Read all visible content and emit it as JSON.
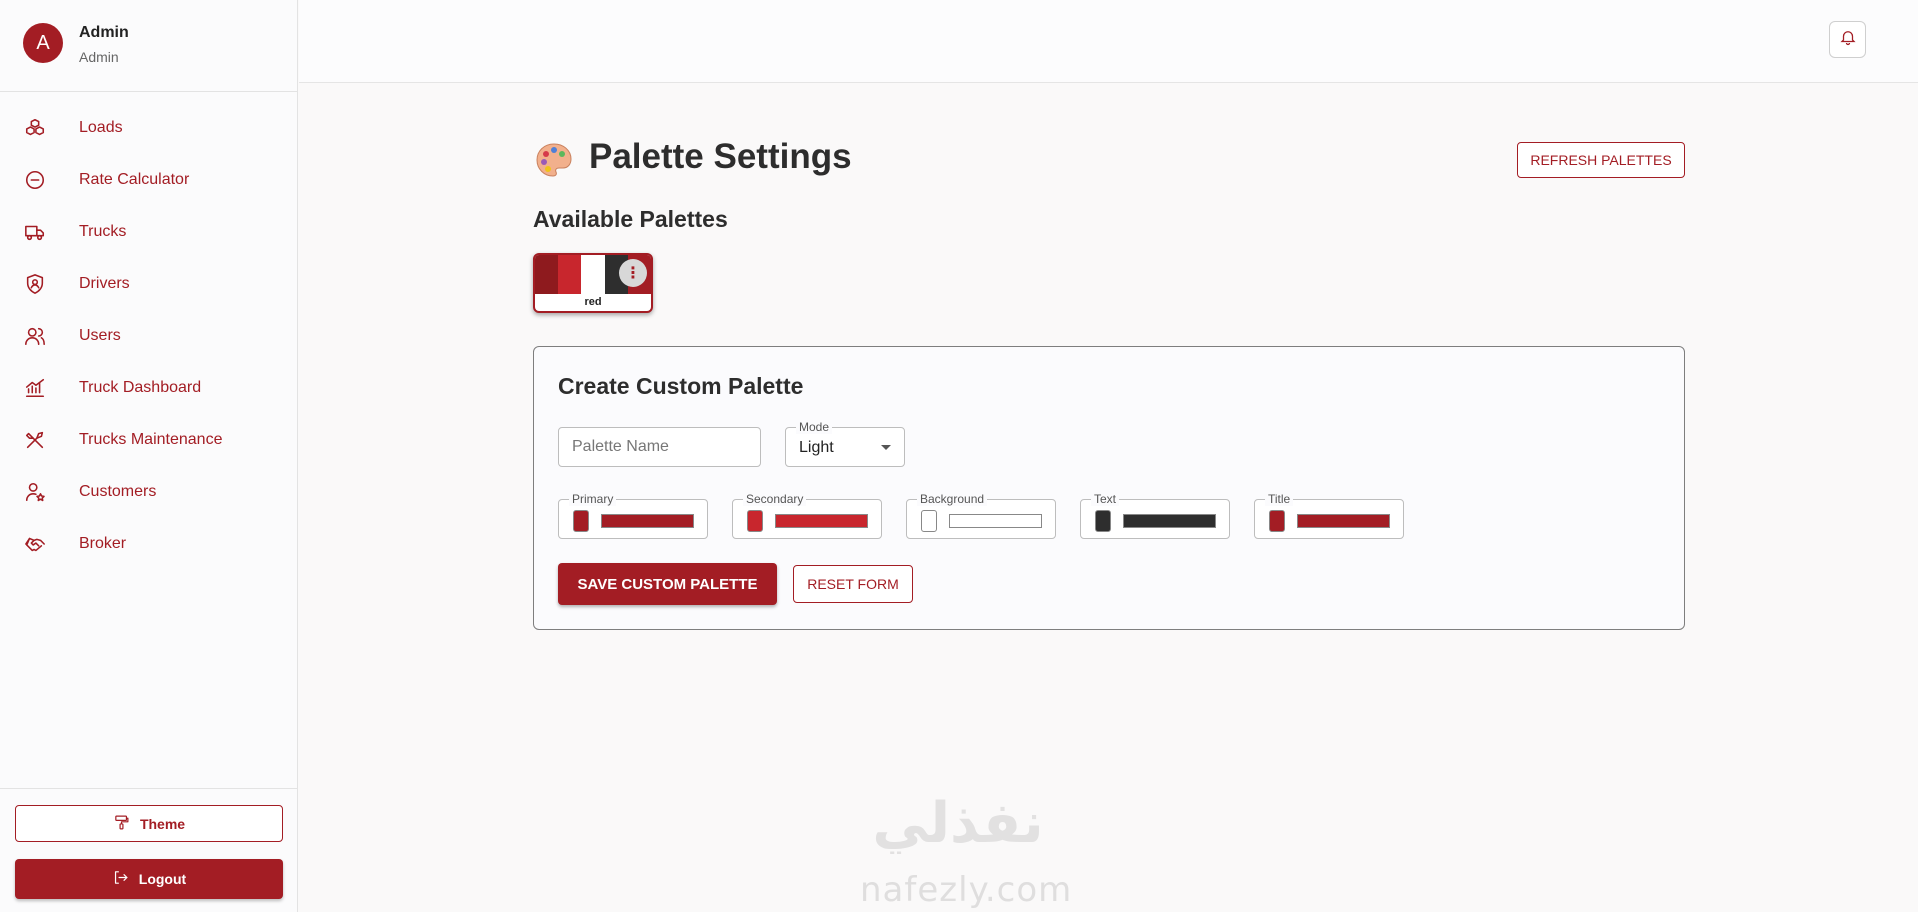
{
  "user": {
    "avatar_letter": "A",
    "name": "Admin",
    "role": "Admin"
  },
  "nav": {
    "items": [
      {
        "label": "Loads",
        "icon": "boxes-icon"
      },
      {
        "label": "Rate Calculator",
        "icon": "calculator-icon"
      },
      {
        "label": "Trucks",
        "icon": "truck-icon"
      },
      {
        "label": "Drivers",
        "icon": "shield-user-icon"
      },
      {
        "label": "Users",
        "icon": "users-icon"
      },
      {
        "label": "Truck Dashboard",
        "icon": "chart-line-icon"
      },
      {
        "label": "Trucks Maintenance",
        "icon": "tools-icon"
      },
      {
        "label": "Customers",
        "icon": "user-star-icon"
      },
      {
        "label": "Broker",
        "icon": "handshake-icon"
      }
    ]
  },
  "sidebar_bottom": {
    "theme_label": "Theme",
    "logout_label": "Logout"
  },
  "header": {
    "notification_icon": "bell-icon"
  },
  "main": {
    "title": "Palette Settings",
    "refresh_label": "REFRESH PALETTES",
    "available_title": "Available Palettes",
    "palettes": [
      {
        "name": "red",
        "colors": [
          "#8e1a1e",
          "#c8262d",
          "#ffffff",
          "#2e2e2e",
          "#a31d24"
        ]
      }
    ]
  },
  "form": {
    "title": "Create Custom Palette",
    "name_placeholder": "Palette Name",
    "mode_label": "Mode",
    "mode_value": "Light",
    "colors": [
      {
        "label": "Primary",
        "value": "#a31d24"
      },
      {
        "label": "Secondary",
        "value": "#c8262d"
      },
      {
        "label": "Background",
        "value": "#ffffff"
      },
      {
        "label": "Text",
        "value": "#2e2e2e"
      },
      {
        "label": "Title",
        "value": "#a31d24"
      }
    ],
    "save_label": "SAVE CUSTOM PALETTE",
    "reset_label": "RESET FORM"
  },
  "watermark": {
    "latin": "nafezly.com",
    "arabic": "نفذلي"
  },
  "theme": {
    "accent": "#a31d24"
  }
}
